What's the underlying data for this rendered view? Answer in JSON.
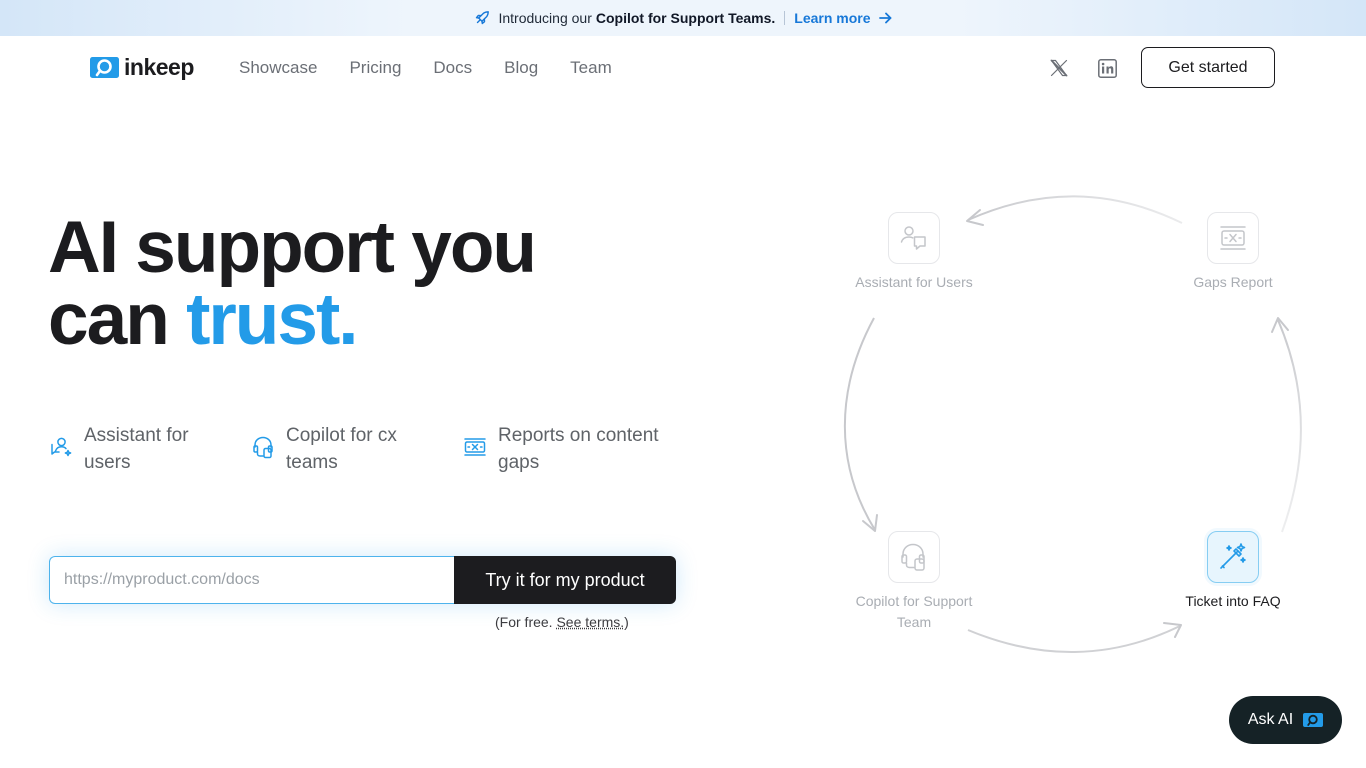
{
  "banner": {
    "intro": "Introducing our",
    "highlight": "Copilot for Support Teams.",
    "link": "Learn more",
    "icon": "rocket-icon"
  },
  "nav": {
    "brand": "inkeep",
    "links": [
      "Showcase",
      "Pricing",
      "Docs",
      "Blog",
      "Team"
    ],
    "social": [
      "x-icon",
      "linkedin-icon"
    ],
    "cta": "Get started"
  },
  "hero": {
    "title_line1": "AI support you",
    "title_line2_prefix": "can ",
    "title_accent": "trust.",
    "features": [
      {
        "icon": "user-chat-icon",
        "label": "Assistant for users"
      },
      {
        "icon": "headset-icon",
        "label": "Copilot for cx teams"
      },
      {
        "icon": "report-gaps-icon",
        "label": "Reports on content gaps"
      }
    ],
    "input_placeholder": "https://myproduct.com/docs",
    "button": "Try it for my product",
    "terms_prefix": "(For free. ",
    "terms_link": "See terms.",
    "terms_suffix": ")"
  },
  "diagram": {
    "nodes": [
      {
        "label": "Assistant for Users",
        "icon": "user-chat-icon",
        "active": false
      },
      {
        "label": "Gaps Report",
        "icon": "report-gaps-icon",
        "active": false
      },
      {
        "label": "Copilot for Support Team",
        "icon": "headset-icon",
        "active": false
      },
      {
        "label": "Ticket into FAQ",
        "icon": "magic-wand-icon",
        "active": true
      }
    ]
  },
  "ask_ai": {
    "label": "Ask AI",
    "icon": "inkeep-logo-icon"
  },
  "colors": {
    "accent": "#239be8",
    "link": "#1778d8",
    "dark": "#1c1c1f",
    "askai_bg": "#152226"
  }
}
